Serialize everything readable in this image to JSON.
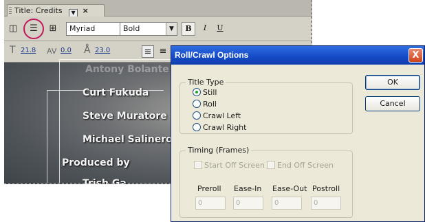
{
  "panel": {
    "tab_title": "Title: Credits",
    "tab_close": "×",
    "tab_menu": "▼",
    "font_family": "Myriad",
    "font_style": "Bold",
    "format_buttons": [
      "B",
      "I",
      "U"
    ],
    "font_size": "21.8",
    "kerning": "0.0",
    "leading": "23.0"
  },
  "credits": {
    "lines": [
      "Antony Bolante",
      "Curt Fukuda",
      "Steve Muratore",
      "Michael Salinero",
      "Produced by",
      "Trish Ga"
    ]
  },
  "dialog": {
    "title": "Roll/Crawl Options",
    "close": "X",
    "title_type": {
      "label": "Title Type",
      "options": [
        "Still",
        "Roll",
        "Crawl Left",
        "Crawl Right"
      ],
      "selected": "Still"
    },
    "timing": {
      "label": "Timing (Frames)",
      "start_off": "Start Off Screen",
      "end_off": "End Off Screen",
      "fields": [
        {
          "label": "Preroll",
          "value": "0"
        },
        {
          "label": "Ease-In",
          "value": "0"
        },
        {
          "label": "Ease-Out",
          "value": "0"
        },
        {
          "label": "Postroll",
          "value": "0"
        }
      ]
    },
    "ok": "OK",
    "cancel": "Cancel"
  },
  "colors": {
    "titlebar": "#1549c5",
    "highlight": "#c2185b",
    "radio_selected": "#21a121"
  }
}
